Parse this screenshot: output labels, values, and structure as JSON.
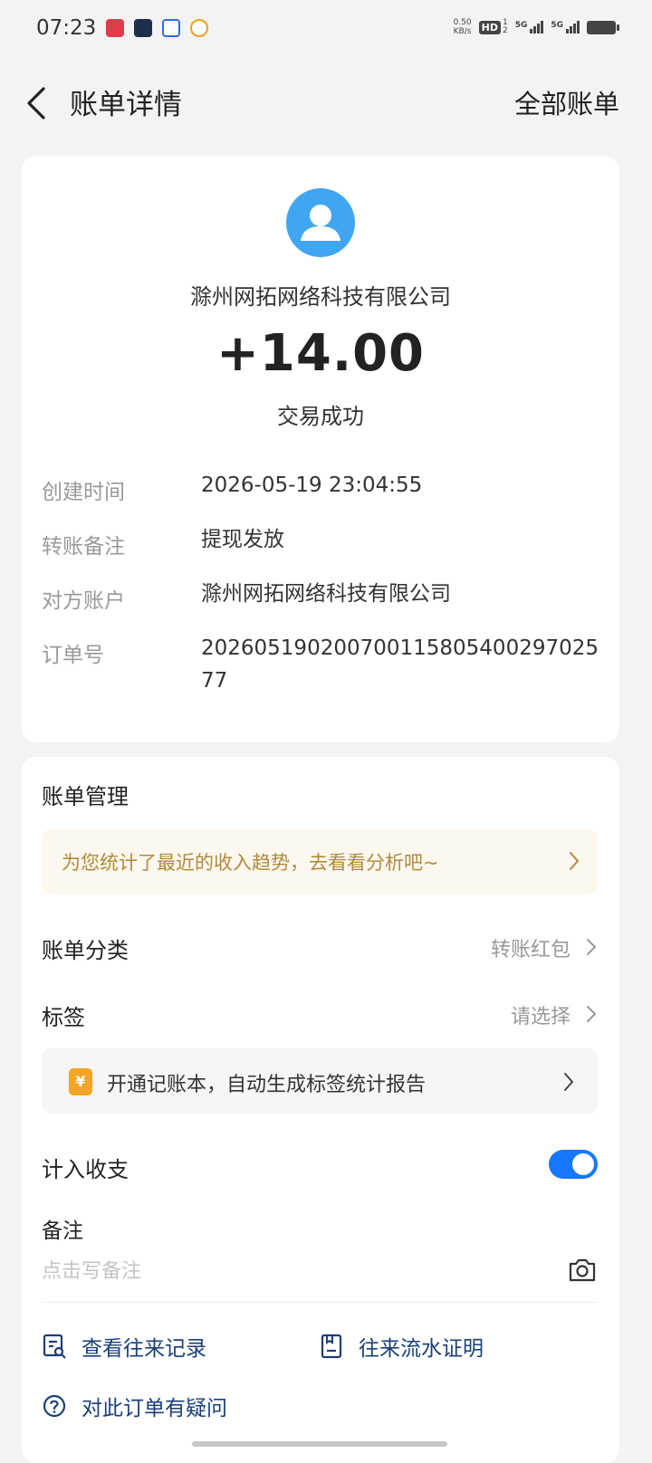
{
  "status_bar": {
    "time": "07:23",
    "net_speed_value": "0.50",
    "net_speed_unit": "KB/s",
    "hd_label": "HD",
    "hd_sims": [
      "1",
      "2"
    ],
    "signal1_label": "5G",
    "signal2_label": "5G"
  },
  "header": {
    "title": "账单详情",
    "all_bills": "全部账单"
  },
  "transaction": {
    "merchant": "滁州网拓网络科技有限公司",
    "amount": "+14.00",
    "status": "交易成功"
  },
  "details": [
    {
      "label": "创建时间",
      "value": "2026-05-19 23:04:55"
    },
    {
      "label": "转账备注",
      "value": "提现发放"
    },
    {
      "label": "对方账户",
      "value": "滁州网拓网络科技有限公司"
    },
    {
      "label": "订单号",
      "value": "20260519020070011580540029702577"
    }
  ],
  "management": {
    "title": "账单管理",
    "promo": "为您统计了最近的收入趋势，去看看分析吧~",
    "category_label": "账单分类",
    "category_value": "转账红包",
    "tag_label": "标签",
    "tag_value": "请选择",
    "ledger_icon": "¥",
    "ledger_text": "开通记账本，自动生成标签统计报告",
    "count_label": "计入收支",
    "count_enabled": true,
    "note_label": "备注",
    "note_placeholder": "点击写备注"
  },
  "links": {
    "records": "查看往来记录",
    "proof": "往来流水证明",
    "question": "对此订单有疑问"
  },
  "colors": {
    "accent": "#1677ff",
    "avatar": "#40a6f2",
    "promo_text": "#b08a3c",
    "link": "#1a3f7a"
  }
}
